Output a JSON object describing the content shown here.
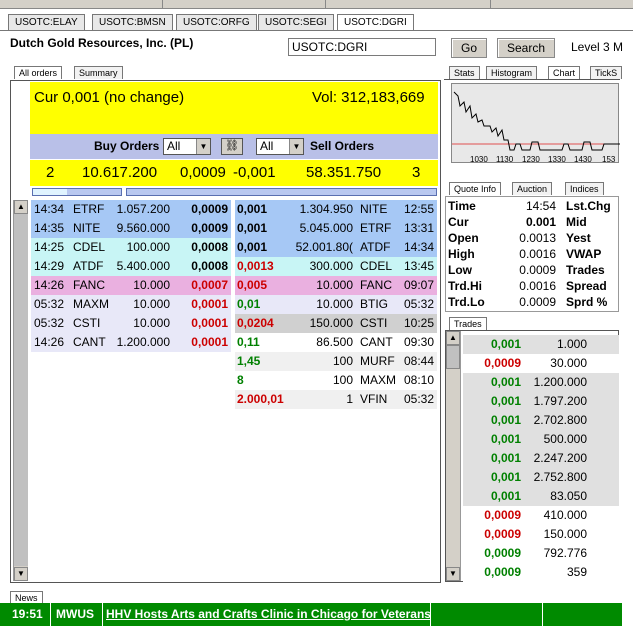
{
  "symbol_tabs": [
    "USOTC:ELAY",
    "USOTC:BMSN",
    "USOTC:ORFG",
    "USOTC:SEGI",
    "USOTC:DGRI"
  ],
  "company": "Dutch Gold Resources, Inc. (PL)",
  "symbol_input": "USOTC:DGRI",
  "buttons": {
    "go": "Go",
    "search": "Search"
  },
  "level": "Level 3 M",
  "view_tabs": [
    "All orders",
    "Summary"
  ],
  "summary": {
    "cur": "Cur 0,001 (no change)",
    "vol": "Vol: 312,183,669"
  },
  "order_bar": {
    "buy_label": "Buy Orders",
    "sell_label": "Sell Orders",
    "buy_filter": "All",
    "sell_filter": "All"
  },
  "totals": {
    "buy_count": "2",
    "buy_size": "10.617.200",
    "buy_price": "0,0009",
    "sell_price": "-0,001",
    "sell_size": "58.351.750",
    "sell_count": "3"
  },
  "buy_orders": [
    {
      "time": "14:34",
      "mm": "ETRF",
      "size": "1.057.200",
      "price": "0,0009",
      "bg": "#a6c8f5"
    },
    {
      "time": "14:35",
      "mm": "NITE",
      "size": "9.560.000",
      "price": "0,0009",
      "bg": "#a6c8f5"
    },
    {
      "time": "14:25",
      "mm": "CDEL",
      "size": "100.000",
      "price": "0,0008",
      "bg": "#c8f5f5"
    },
    {
      "time": "14:29",
      "mm": "ATDF",
      "size": "5.400.000",
      "price": "0,0008",
      "bg": "#c8f5f5"
    },
    {
      "time": "14:26",
      "mm": "FANC",
      "size": "10.000",
      "price": "0,0007",
      "bg": "#eab0e0"
    },
    {
      "time": "05:32",
      "mm": "MAXM",
      "size": "10.000",
      "price": "0,0001",
      "bg": "#e8e8f8"
    },
    {
      "time": "05:32",
      "mm": "CSTI",
      "size": "10.000",
      "price": "0,0001",
      "bg": "#e8e8f8"
    },
    {
      "time": "14:26",
      "mm": "CANT",
      "size": "1.200.000",
      "price": "0,0001",
      "bg": "#e8e8f8"
    }
  ],
  "sell_orders": [
    {
      "price": "0,001",
      "size": "1.304.950",
      "mm": "NITE",
      "time": "12:55",
      "bg": "#a6c8f5",
      "cls": "blk"
    },
    {
      "price": "0,001",
      "size": "5.045.000",
      "mm": "ETRF",
      "time": "13:31",
      "bg": "#a6c8f5",
      "cls": "blk"
    },
    {
      "price": "0,001",
      "size": "52.001.80(",
      "mm": "ATDF",
      "time": "14:34",
      "bg": "#a6c8f5",
      "cls": "blk"
    },
    {
      "price": "0,0013",
      "size": "300.000",
      "mm": "CDEL",
      "time": "13:45",
      "bg": "#c8f5f5",
      "cls": "red"
    },
    {
      "price": "0,005",
      "size": "10.000",
      "mm": "FANC",
      "time": "09:07",
      "bg": "#eab0e0",
      "cls": "red"
    },
    {
      "price": "0,01",
      "size": "10.000",
      "mm": "BTIG",
      "time": "05:32",
      "bg": "#e8e8f8",
      "cls": "grn"
    },
    {
      "price": "0,0204",
      "size": "150.000",
      "mm": "CSTI",
      "time": "10:25",
      "bg": "#d0d0d0",
      "cls": "red"
    },
    {
      "price": "0,11",
      "size": "86.500",
      "mm": "CANT",
      "time": "09:30",
      "bg": "#ffffff",
      "cls": "grn"
    },
    {
      "price": "1,45",
      "size": "100",
      "mm": "MURF",
      "time": "08:44",
      "bg": "#f0f0f0",
      "cls": "grn"
    },
    {
      "price": "8",
      "size": "100",
      "mm": "MAXM",
      "time": "08:10",
      "bg": "#ffffff",
      "cls": "grn"
    },
    {
      "price": "2.000,01",
      "size": "1",
      "mm": "VFIN",
      "time": "05:32",
      "bg": "#f0f0f0",
      "cls": "red"
    }
  ],
  "right_tabs": [
    "Stats",
    "Histogram",
    "Chart",
    "TickS"
  ],
  "chart_xlabels": [
    "1030",
    "1130",
    "1230",
    "1330",
    "1430",
    "153"
  ],
  "quote_tabs": [
    "Quote Info",
    "Auction",
    "Indices"
  ],
  "quote_info": [
    {
      "l": "Time",
      "v": "14:54",
      "l2": "Lst.Chg",
      "b": false
    },
    {
      "l": "Cur",
      "v": "0.001",
      "l2": "Mid",
      "b": true
    },
    {
      "l": "Open",
      "v": "0.0013",
      "l2": "Yest",
      "b": false
    },
    {
      "l": "High",
      "v": "0.0016",
      "l2": "VWAP",
      "b": false
    },
    {
      "l": "Low",
      "v": "0.0009",
      "l2": "Trades",
      "b": false
    },
    {
      "l": "Trd.Hi",
      "v": "0.0016",
      "l2": "Spread",
      "b": false
    },
    {
      "l": "Trd.Lo",
      "v": "0.0009",
      "l2": "Sprd %",
      "b": false
    }
  ],
  "trades_tab": "Trades",
  "trades": [
    {
      "p": "0,001",
      "s": "1.000",
      "c": "grn",
      "bg": "#e0e0e0"
    },
    {
      "p": "0,0009",
      "s": "30.000",
      "c": "red",
      "bg": "#ffffff"
    },
    {
      "p": "0,001",
      "s": "1.200.000",
      "c": "grn",
      "bg": "#e0e0e0"
    },
    {
      "p": "0,001",
      "s": "1.797.200",
      "c": "grn",
      "bg": "#e0e0e0"
    },
    {
      "p": "0,001",
      "s": "2.702.800",
      "c": "grn",
      "bg": "#e0e0e0"
    },
    {
      "p": "0,001",
      "s": "500.000",
      "c": "grn",
      "bg": "#e0e0e0"
    },
    {
      "p": "0,001",
      "s": "2.247.200",
      "c": "grn",
      "bg": "#e0e0e0"
    },
    {
      "p": "0,001",
      "s": "2.752.800",
      "c": "grn",
      "bg": "#e0e0e0"
    },
    {
      "p": "0,001",
      "s": "83.050",
      "c": "grn",
      "bg": "#e0e0e0"
    },
    {
      "p": "0,0009",
      "s": "410.000",
      "c": "red",
      "bg": "#ffffff"
    },
    {
      "p": "0,0009",
      "s": "150.000",
      "c": "red",
      "bg": "#ffffff"
    },
    {
      "p": "0,0009",
      "s": "792.776",
      "c": "grn",
      "bg": "#ffffff"
    },
    {
      "p": "0,0009",
      "s": "359",
      "c": "grn",
      "bg": "#ffffff"
    }
  ],
  "news_tab": "News",
  "news": {
    "time": "19:51",
    "source": "MWUS",
    "headline": "HHV Hosts Arts and Crafts Clinic in Chicago for Veterans"
  }
}
